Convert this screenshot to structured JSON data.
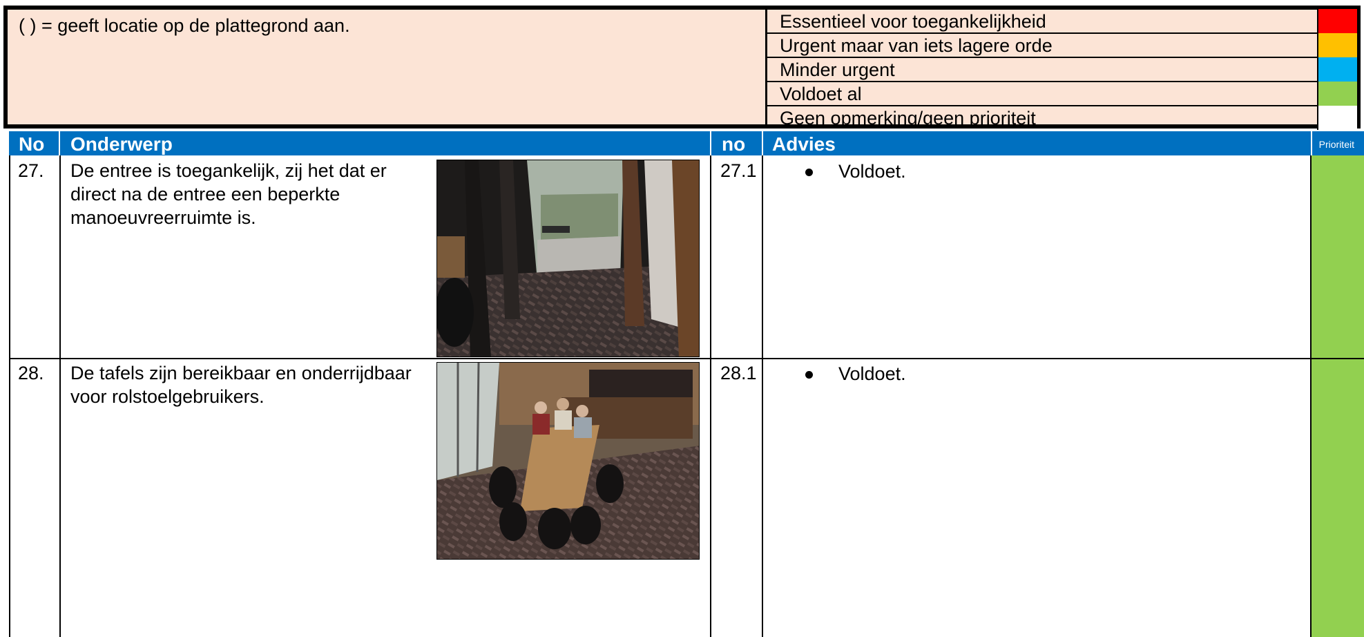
{
  "legend": {
    "note": "( ) = geeft locatie op de plattegrond aan.",
    "levels": [
      {
        "label": "Essentieel voor toegankelijkheid",
        "color": "#ff0000"
      },
      {
        "label": "Urgent maar van iets lagere orde",
        "color": "#ffc000"
      },
      {
        "label": "Minder urgent",
        "color": "#00b0f0"
      },
      {
        "label": "Voldoet al",
        "color": "#92d050"
      },
      {
        "label": "Geen opmerking/geen prioriteit",
        "color": "#ffffff"
      }
    ]
  },
  "table": {
    "headers": {
      "no": "No",
      "topic": "Onderwerp",
      "sub_no": "no",
      "advice": "Advies",
      "priority": "Prioriteit"
    },
    "header_color": "#0070c0",
    "rows": [
      {
        "no": "27.",
        "topic": "De entree is toegankelijk, zij het dat er direct na de entree een beperkte manoeuvreerruimte is.",
        "photo": "entrance-doorway-photo",
        "sub_no": "27.1",
        "advice": "Voldoet.",
        "priority_color": "#92d050"
      },
      {
        "no": "28.",
        "topic": "De tafels zijn bereikbaar en onderrijdbaar voor rolstoelgebruikers.",
        "photo": "dining-tables-photo",
        "sub_no": "28.1",
        "advice": "Voldoet.",
        "priority_color": "#92d050"
      }
    ]
  }
}
